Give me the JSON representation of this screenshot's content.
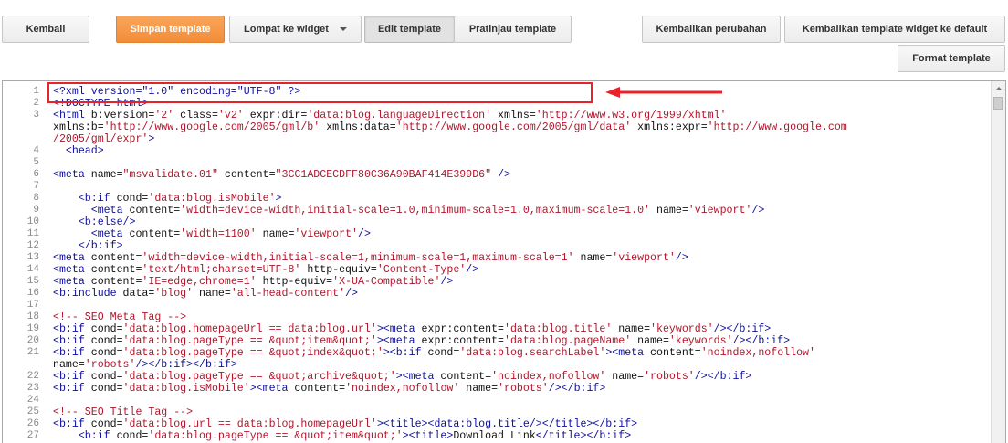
{
  "toolbar": {
    "back_label": "Kembali",
    "save_label": "Simpan template",
    "jump_label": "Lompat ke widget",
    "edit_label": "Edit template",
    "preview_label": "Pratinjau template",
    "revert_label": "Kembalikan perubahan",
    "revert_widget_label": "Kembalikan template widget ke default",
    "format_label": "Format template"
  },
  "editor": {
    "lines": [
      {
        "num": "1",
        "tokens": [
          {
            "c": "t",
            "v": "<?xml version=\"1.0\" encoding=\"UTF-8\" ?>"
          }
        ]
      },
      {
        "num": "2",
        "tokens": [
          {
            "c": "t",
            "v": "<!DOCTYPE html>"
          }
        ]
      },
      {
        "num": "3",
        "tokens": [
          {
            "c": "t",
            "v": "<html "
          },
          {
            "c": "a",
            "v": "b:version="
          },
          {
            "c": "s",
            "v": "'2'"
          },
          {
            "c": "a",
            "v": " class="
          },
          {
            "c": "s",
            "v": "'v2'"
          },
          {
            "c": "a",
            "v": " expr:dir="
          },
          {
            "c": "s",
            "v": "'data:blog.languageDirection'"
          },
          {
            "c": "a",
            "v": " xmlns="
          },
          {
            "c": "s",
            "v": "'http://www.w3.org/1999/xhtml'"
          }
        ]
      },
      {
        "num": "",
        "tokens": [
          {
            "c": "a",
            "v": "xmlns:b="
          },
          {
            "c": "s",
            "v": "'http://www.google.com/2005/gml/b'"
          },
          {
            "c": "a",
            "v": " xmlns:data="
          },
          {
            "c": "s",
            "v": "'http://www.google.com/2005/gml/data'"
          },
          {
            "c": "a",
            "v": " xmlns:expr="
          },
          {
            "c": "s",
            "v": "'http://www.google.com"
          }
        ]
      },
      {
        "num": "",
        "tokens": [
          {
            "c": "s",
            "v": "/2005/gml/expr'"
          },
          {
            "c": "t",
            "v": ">"
          }
        ]
      },
      {
        "num": "4",
        "tokens": [
          {
            "c": "t",
            "v": "  <head>"
          }
        ]
      },
      {
        "num": "5",
        "tokens": []
      },
      {
        "num": "6",
        "tokens": [
          {
            "c": "t",
            "v": "<meta "
          },
          {
            "c": "a",
            "v": "name="
          },
          {
            "c": "s",
            "v": "\"msvalidate.01\""
          },
          {
            "c": "a",
            "v": " content="
          },
          {
            "c": "s",
            "v": "\"3CC1ADCECDFF80C36A90BAF414E399D6\""
          },
          {
            "c": "t",
            "v": " />"
          }
        ]
      },
      {
        "num": "7",
        "tokens": []
      },
      {
        "num": "8",
        "tokens": [
          {
            "c": "t",
            "v": "    <b:if "
          },
          {
            "c": "a",
            "v": "cond="
          },
          {
            "c": "s",
            "v": "'data:blog.isMobile'"
          },
          {
            "c": "t",
            "v": ">"
          }
        ]
      },
      {
        "num": "9",
        "tokens": [
          {
            "c": "t",
            "v": "      <meta "
          },
          {
            "c": "a",
            "v": "content="
          },
          {
            "c": "s",
            "v": "'width=device-width,initial-scale=1.0,minimum-scale=1.0,maximum-scale=1.0'"
          },
          {
            "c": "a",
            "v": " name="
          },
          {
            "c": "s",
            "v": "'viewport'"
          },
          {
            "c": "t",
            "v": "/>"
          }
        ]
      },
      {
        "num": "10",
        "tokens": [
          {
            "c": "t",
            "v": "    <b:else/>"
          }
        ]
      },
      {
        "num": "11",
        "tokens": [
          {
            "c": "t",
            "v": "      <meta "
          },
          {
            "c": "a",
            "v": "content="
          },
          {
            "c": "s",
            "v": "'width=1100'"
          },
          {
            "c": "a",
            "v": " name="
          },
          {
            "c": "s",
            "v": "'viewport'"
          },
          {
            "c": "t",
            "v": "/>"
          }
        ]
      },
      {
        "num": "12",
        "tokens": [
          {
            "c": "t",
            "v": "    </b:if>"
          }
        ]
      },
      {
        "num": "13",
        "tokens": [
          {
            "c": "t",
            "v": "<meta "
          },
          {
            "c": "a",
            "v": "content="
          },
          {
            "c": "s",
            "v": "'width=device-width,initial-scale=1,minimum-scale=1,maximum-scale=1'"
          },
          {
            "c": "a",
            "v": " name="
          },
          {
            "c": "s",
            "v": "'viewport'"
          },
          {
            "c": "t",
            "v": "/>"
          }
        ]
      },
      {
        "num": "14",
        "tokens": [
          {
            "c": "t",
            "v": "<meta "
          },
          {
            "c": "a",
            "v": "content="
          },
          {
            "c": "s",
            "v": "'text/html;charset=UTF-8'"
          },
          {
            "c": "a",
            "v": " http-equiv="
          },
          {
            "c": "s",
            "v": "'Content-Type'"
          },
          {
            "c": "t",
            "v": "/>"
          }
        ]
      },
      {
        "num": "15",
        "tokens": [
          {
            "c": "t",
            "v": "<meta "
          },
          {
            "c": "a",
            "v": "content="
          },
          {
            "c": "s",
            "v": "'IE=edge,chrome=1'"
          },
          {
            "c": "a",
            "v": " http-equiv="
          },
          {
            "c": "s",
            "v": "'X-UA-Compatible'"
          },
          {
            "c": "t",
            "v": "/>"
          }
        ]
      },
      {
        "num": "16",
        "tokens": [
          {
            "c": "t",
            "v": "<b:include "
          },
          {
            "c": "a",
            "v": "data="
          },
          {
            "c": "s",
            "v": "'blog'"
          },
          {
            "c": "a",
            "v": " name="
          },
          {
            "c": "s",
            "v": "'all-head-content'"
          },
          {
            "c": "t",
            "v": "/>"
          }
        ]
      },
      {
        "num": "17",
        "tokens": []
      },
      {
        "num": "18",
        "tokens": [
          {
            "c": "c",
            "v": "<!-- SEO Meta Tag -->"
          }
        ]
      },
      {
        "num": "19",
        "tokens": [
          {
            "c": "t",
            "v": "<b:if "
          },
          {
            "c": "a",
            "v": "cond="
          },
          {
            "c": "s",
            "v": "'data:blog.homepageUrl == data:blog.url'"
          },
          {
            "c": "t",
            "v": "><meta "
          },
          {
            "c": "a",
            "v": "expr:content="
          },
          {
            "c": "s",
            "v": "'data:blog.title'"
          },
          {
            "c": "a",
            "v": " name="
          },
          {
            "c": "s",
            "v": "'keywords'"
          },
          {
            "c": "t",
            "v": "/></b:if>"
          }
        ]
      },
      {
        "num": "20",
        "tokens": [
          {
            "c": "t",
            "v": "<b:if "
          },
          {
            "c": "a",
            "v": "cond="
          },
          {
            "c": "s",
            "v": "'data:blog.pageType == &quot;item&quot;'"
          },
          {
            "c": "t",
            "v": "><meta "
          },
          {
            "c": "a",
            "v": "expr:content="
          },
          {
            "c": "s",
            "v": "'data:blog.pageName'"
          },
          {
            "c": "a",
            "v": " name="
          },
          {
            "c": "s",
            "v": "'keywords'"
          },
          {
            "c": "t",
            "v": "/></b:if>"
          }
        ]
      },
      {
        "num": "21",
        "tokens": [
          {
            "c": "t",
            "v": "<b:if "
          },
          {
            "c": "a",
            "v": "cond="
          },
          {
            "c": "s",
            "v": "'data:blog.pageType == &quot;index&quot;'"
          },
          {
            "c": "t",
            "v": "><b:if "
          },
          {
            "c": "a",
            "v": "cond="
          },
          {
            "c": "s",
            "v": "'data:blog.searchLabel'"
          },
          {
            "c": "t",
            "v": "><meta "
          },
          {
            "c": "a",
            "v": "content="
          },
          {
            "c": "s",
            "v": "'noindex,nofollow'"
          }
        ]
      },
      {
        "num": "",
        "tokens": [
          {
            "c": "a",
            "v": "name="
          },
          {
            "c": "s",
            "v": "'robots'"
          },
          {
            "c": "t",
            "v": "/></b:if></b:if>"
          }
        ]
      },
      {
        "num": "22",
        "tokens": [
          {
            "c": "t",
            "v": "<b:if "
          },
          {
            "c": "a",
            "v": "cond="
          },
          {
            "c": "s",
            "v": "'data:blog.pageType == &quot;archive&quot;'"
          },
          {
            "c": "t",
            "v": "><meta "
          },
          {
            "c": "a",
            "v": "content="
          },
          {
            "c": "s",
            "v": "'noindex,nofollow'"
          },
          {
            "c": "a",
            "v": " name="
          },
          {
            "c": "s",
            "v": "'robots'"
          },
          {
            "c": "t",
            "v": "/></b:if>"
          }
        ]
      },
      {
        "num": "23",
        "tokens": [
          {
            "c": "t",
            "v": "<b:if "
          },
          {
            "c": "a",
            "v": "cond="
          },
          {
            "c": "s",
            "v": "'data:blog.isMobile'"
          },
          {
            "c": "t",
            "v": "><meta "
          },
          {
            "c": "a",
            "v": "content="
          },
          {
            "c": "s",
            "v": "'noindex,nofollow'"
          },
          {
            "c": "a",
            "v": " name="
          },
          {
            "c": "s",
            "v": "'robots'"
          },
          {
            "c": "t",
            "v": "/></b:if>"
          }
        ]
      },
      {
        "num": "24",
        "tokens": []
      },
      {
        "num": "25",
        "tokens": [
          {
            "c": "c",
            "v": "<!-- SEO Title Tag -->"
          }
        ]
      },
      {
        "num": "26",
        "tokens": [
          {
            "c": "t",
            "v": "<b:if "
          },
          {
            "c": "a",
            "v": "cond="
          },
          {
            "c": "s",
            "v": "'data:blog.url == data:blog.homepageUrl'"
          },
          {
            "c": "t",
            "v": "><title><data:blog.title/></title></b:if>"
          }
        ]
      },
      {
        "num": "27",
        "tokens": [
          {
            "c": "t",
            "v": "    <b:if "
          },
          {
            "c": "a",
            "v": "cond="
          },
          {
            "c": "s",
            "v": "'data:blog.pageType == &quot;item&quot;'"
          },
          {
            "c": "t",
            "v": "><title>"
          },
          {
            "c": "a",
            "v": "Download Link"
          },
          {
            "c": "t",
            "v": "</title></b:if>"
          }
        ]
      }
    ]
  },
  "colors": {
    "accent": "#f28d39",
    "highlight_border": "#e8222a",
    "tag": "#0e0e9e",
    "string": "#b1152b"
  },
  "icons": {
    "dropdown": "chevron-down-icon",
    "annotation": "arrow-left-icon"
  }
}
